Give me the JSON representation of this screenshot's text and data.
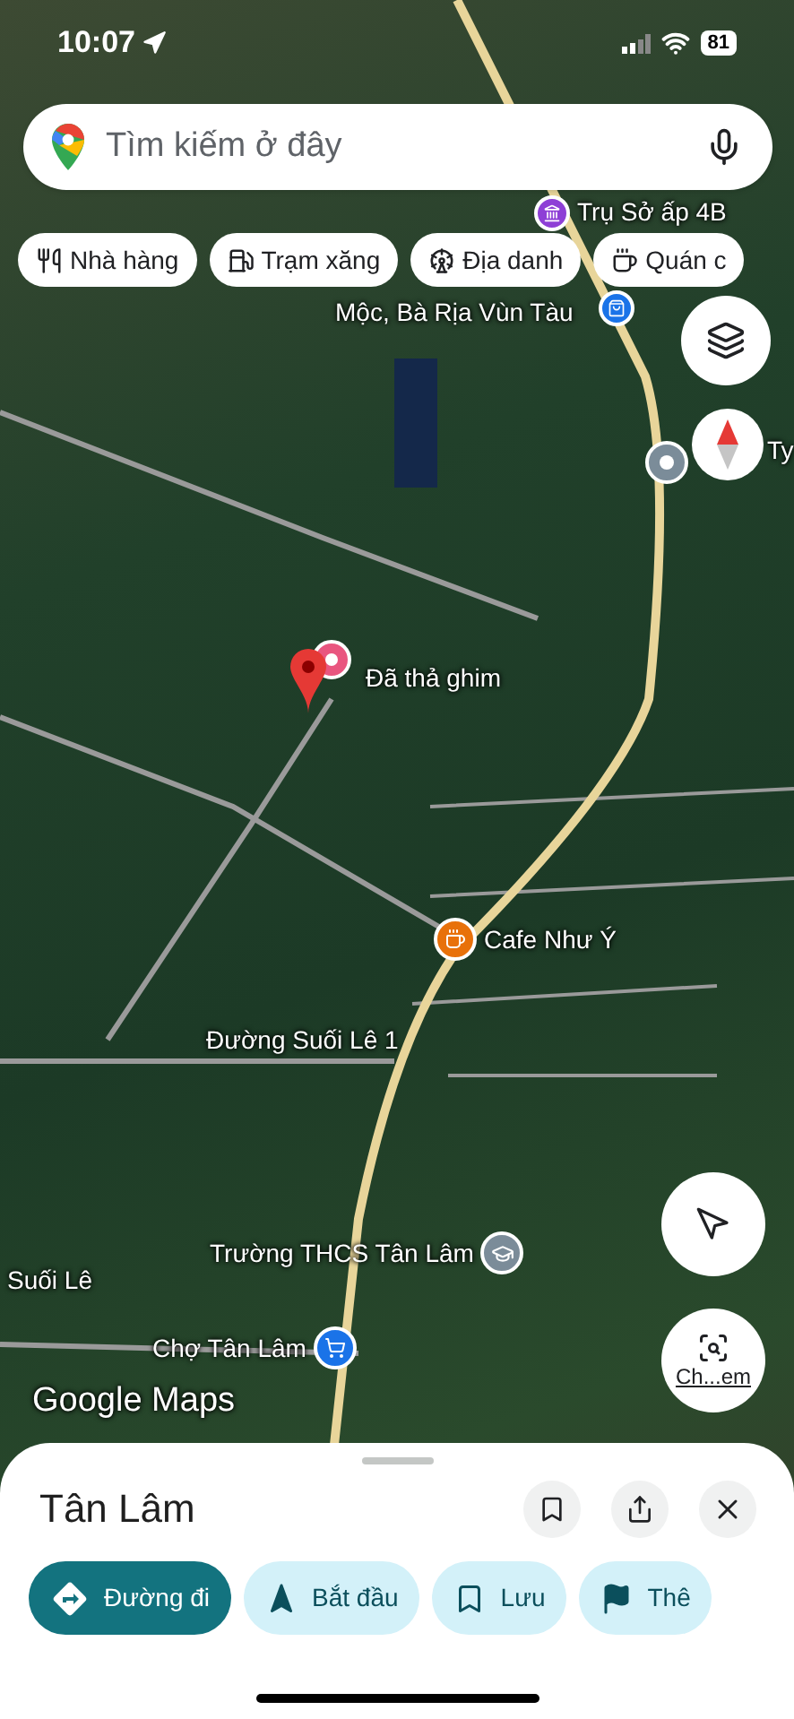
{
  "status_bar": {
    "time": "10:07",
    "battery": "81"
  },
  "search": {
    "placeholder": "Tìm kiếm ở đây"
  },
  "chips": [
    {
      "label": "Nhà hàng"
    },
    {
      "label": "Trạm xăng"
    },
    {
      "label": "Địa danh"
    },
    {
      "label": "Quán c"
    }
  ],
  "map_labels": [
    {
      "kind": "office",
      "text": "Trụ Sở ấp 4B"
    },
    {
      "kind": "text",
      "text": "Mộc, Bà Rịa Vùn Tàu"
    },
    {
      "kind": "store"
    },
    {
      "kind": "gray"
    },
    {
      "kind": "text",
      "text": "Ty"
    },
    {
      "kind": "dropped",
      "text": "Đã thả ghim"
    },
    {
      "kind": "cafe",
      "text": "Cafe Như Ý"
    },
    {
      "kind": "text",
      "text": "Đường Suối Lê 1"
    },
    {
      "kind": "school",
      "text": "Trường THCS Tân Lâm"
    },
    {
      "kind": "text",
      "text": "Suối Lê"
    },
    {
      "kind": "market",
      "text": "Chợ Tân Lâm"
    }
  ],
  "map_logo": "Google Maps",
  "lens_button": {
    "label": "Ch...em"
  },
  "sheet": {
    "title": "Tân Lâm"
  },
  "actions": [
    {
      "label": "Đường đi",
      "primary": true
    },
    {
      "label": "Bắt đầu",
      "primary": false
    },
    {
      "label": "Lưu",
      "primary": false
    },
    {
      "label": "Thê",
      "primary": false
    }
  ]
}
